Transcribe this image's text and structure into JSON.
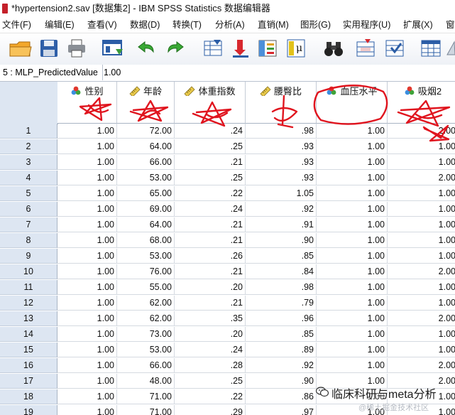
{
  "window": {
    "title": "*hypertension2.sav [数据集2] - IBM SPSS Statistics 数据编辑器"
  },
  "menu": [
    "文件(F)",
    "编辑(E)",
    "查看(V)",
    "数据(D)",
    "转换(T)",
    "分析(A)",
    "直销(M)",
    "图形(G)",
    "实用程序(U)",
    "扩展(X)",
    "窗"
  ],
  "toolbar": {
    "buttons": [
      "open-folder-icon",
      "save-disk-icon",
      "print-icon",
      "recall-dialog-icon",
      "undo-icon",
      "redo-icon",
      "goto-case-icon",
      "goto-variable-icon",
      "variables-icon",
      "value-labels-icon",
      "find-binoculars-icon",
      "insert-cases-icon",
      "split-file-icon",
      "select-cases-icon",
      "grid-view-icon",
      "scale-icon"
    ]
  },
  "cell_editor": {
    "reference": "5 : MLP_PredictedValue",
    "value": "1.00"
  },
  "columns": [
    {
      "label": "性别",
      "icon": "nominal-icon"
    },
    {
      "label": "年龄",
      "icon": "scale-ruler-icon"
    },
    {
      "label": "体重指数",
      "icon": "scale-ruler-icon"
    },
    {
      "label": "腰臀比",
      "icon": "scale-ruler-icon"
    },
    {
      "label": "血压水平",
      "icon": "nominal-icon"
    },
    {
      "label": "吸烟2",
      "icon": "nominal-icon"
    }
  ],
  "rows": [
    {
      "n": "1",
      "cells": [
        "1.00",
        "72.00",
        ".24",
        ".98",
        "1.00",
        "2.00"
      ]
    },
    {
      "n": "2",
      "cells": [
        "1.00",
        "64.00",
        ".25",
        ".93",
        "1.00",
        "1.00"
      ]
    },
    {
      "n": "3",
      "cells": [
        "1.00",
        "66.00",
        ".21",
        ".93",
        "1.00",
        "1.00"
      ]
    },
    {
      "n": "4",
      "cells": [
        "1.00",
        "53.00",
        ".25",
        ".93",
        "1.00",
        "2.00"
      ]
    },
    {
      "n": "5",
      "cells": [
        "1.00",
        "65.00",
        ".22",
        "1.05",
        "1.00",
        "1.00"
      ]
    },
    {
      "n": "6",
      "cells": [
        "1.00",
        "69.00",
        ".24",
        ".92",
        "1.00",
        "1.00"
      ]
    },
    {
      "n": "7",
      "cells": [
        "1.00",
        "64.00",
        ".21",
        ".91",
        "1.00",
        "1.00"
      ]
    },
    {
      "n": "8",
      "cells": [
        "1.00",
        "68.00",
        ".21",
        ".90",
        "1.00",
        "1.00"
      ]
    },
    {
      "n": "9",
      "cells": [
        "1.00",
        "53.00",
        ".26",
        ".85",
        "1.00",
        "1.00"
      ]
    },
    {
      "n": "10",
      "cells": [
        "1.00",
        "76.00",
        ".21",
        ".84",
        "1.00",
        "2.00"
      ]
    },
    {
      "n": "11",
      "cells": [
        "1.00",
        "55.00",
        ".20",
        ".98",
        "1.00",
        "1.00"
      ]
    },
    {
      "n": "12",
      "cells": [
        "1.00",
        "62.00",
        ".21",
        ".79",
        "1.00",
        "1.00"
      ]
    },
    {
      "n": "13",
      "cells": [
        "1.00",
        "62.00",
        ".35",
        ".96",
        "1.00",
        "2.00"
      ]
    },
    {
      "n": "14",
      "cells": [
        "1.00",
        "73.00",
        ".20",
        ".85",
        "1.00",
        "1.00"
      ]
    },
    {
      "n": "15",
      "cells": [
        "1.00",
        "53.00",
        ".24",
        ".89",
        "1.00",
        "1.00"
      ]
    },
    {
      "n": "16",
      "cells": [
        "1.00",
        "66.00",
        ".28",
        ".92",
        "1.00",
        "2.00"
      ]
    },
    {
      "n": "17",
      "cells": [
        "1.00",
        "48.00",
        ".25",
        ".90",
        "1.00",
        "2.00"
      ]
    },
    {
      "n": "18",
      "cells": [
        "1.00",
        "71.00",
        ".22",
        ".86",
        "1.00",
        "1.00"
      ]
    },
    {
      "n": "19",
      "cells": [
        "1.00",
        "71.00",
        ".29",
        ".97",
        "1.00",
        "1.00"
      ]
    }
  ],
  "watermark": {
    "line1": "临床科研与meta分析",
    "line2": "@稀土掘金技术社区"
  },
  "colors": {
    "annotation_red": "#e0141e",
    "row_header_bg": "#dde6f2",
    "grid_line": "#d5dae1"
  }
}
